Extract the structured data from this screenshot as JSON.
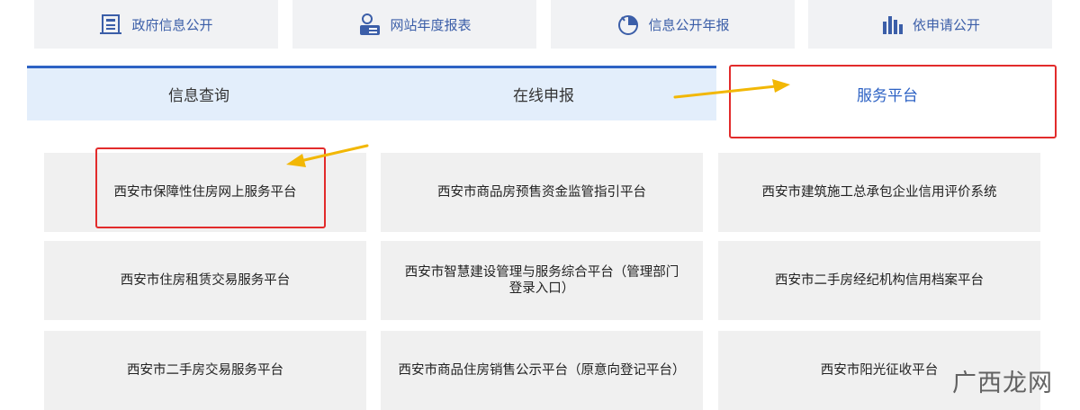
{
  "top_links": [
    {
      "label": "政府信息公开",
      "icon": "document-building-icon"
    },
    {
      "label": "网站年度报表",
      "icon": "user-report-icon"
    },
    {
      "label": "信息公开年报",
      "icon": "annual-report-icon"
    },
    {
      "label": "依申请公开",
      "icon": "bar-chart-icon"
    }
  ],
  "tabs": [
    {
      "label": "信息查询"
    },
    {
      "label": "在线申报"
    },
    {
      "label": "服务平台"
    }
  ],
  "platforms": [
    {
      "label": "西安市保障性住房网上服务平台"
    },
    {
      "label": "西安市商品房预售资金监管指引平台"
    },
    {
      "label": "西安市建筑施工总承包企业信用评价系统"
    },
    {
      "label": "西安市住房租赁交易服务平台"
    },
    {
      "label": "西安市智慧建设管理与服务综合平台（管理部门登录入口）"
    },
    {
      "label": "西安市二手房经纪机构信用档案平台"
    },
    {
      "label": "西安市二手房交易服务平台"
    },
    {
      "label": "西安市商品住房销售公示平台（原意向登记平台）"
    },
    {
      "label": "西安市阳光征收平台"
    }
  ],
  "watermark": "广西龙网",
  "colors": {
    "accent": "#2d62c4",
    "highlight_box": "#e22b2b",
    "arrow": "#f2b705"
  }
}
